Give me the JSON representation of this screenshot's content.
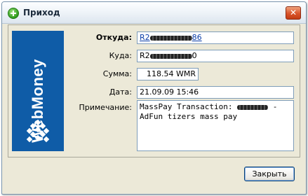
{
  "window": {
    "title": "Приход",
    "close_glyph": "✕"
  },
  "logo": {
    "text": "WebMoney",
    "color": "#0f5ca7"
  },
  "form": {
    "from": {
      "label": "Откуда:",
      "value_prefix": "R2",
      "value_suffix": "86"
    },
    "to": {
      "label": "Куда:",
      "value_prefix": "R2",
      "value_suffix": "0"
    },
    "amount": {
      "label": "Сумма:",
      "value": "118.54 WMR"
    },
    "date": {
      "label": "Дата:",
      "value": "21.09.09 15:46"
    },
    "note": {
      "label": "Примечание:",
      "line1_prefix": "MassPay Transaction:",
      "line1_suffix": " -",
      "line2": "AdFun tizers mass pay"
    }
  },
  "buttons": {
    "close_label": "Закрыть"
  }
}
